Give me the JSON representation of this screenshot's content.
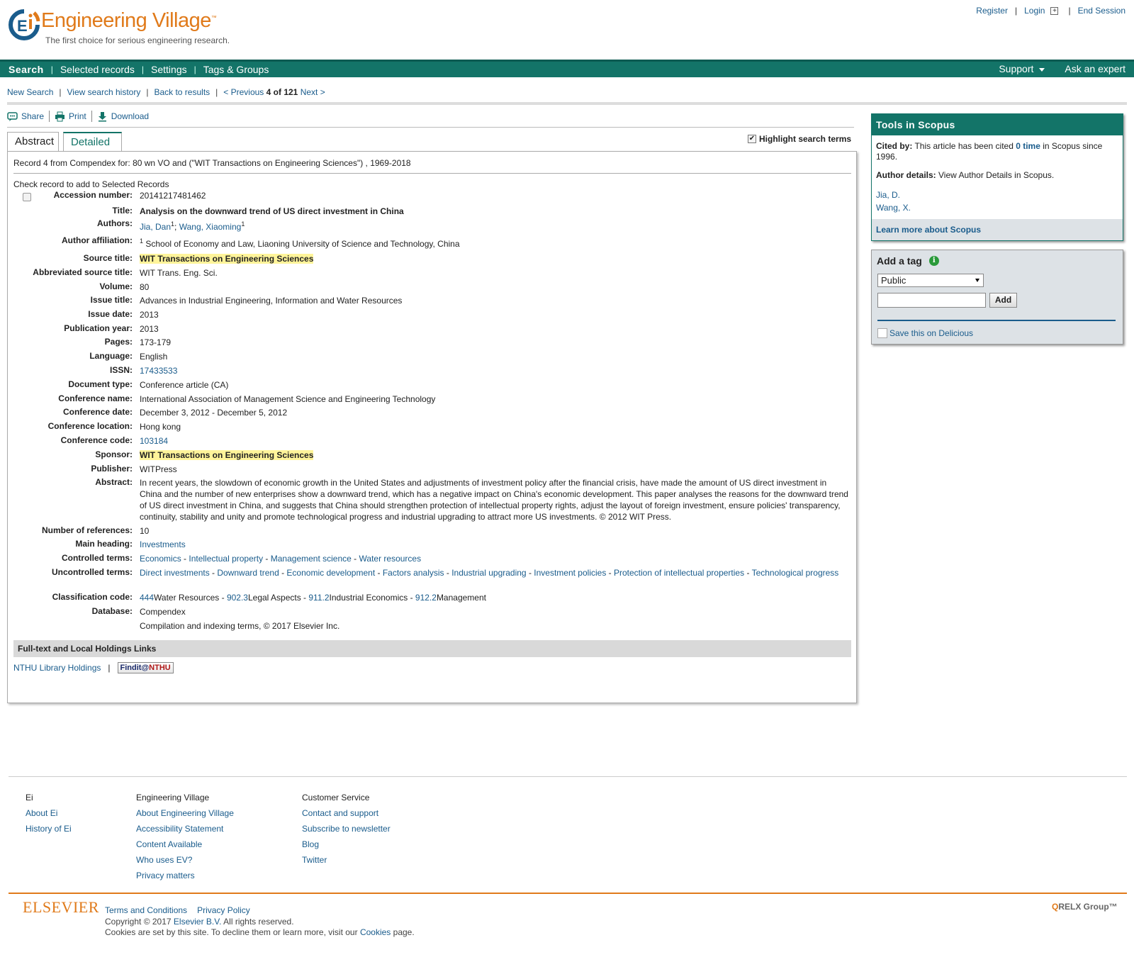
{
  "header": {
    "brand": "Engineering Village",
    "brand_tm": "™",
    "tagline": "The first choice for serious engineering research.",
    "register": "Register",
    "login": "Login",
    "end_session": "End Session"
  },
  "nav": {
    "items": [
      "Search",
      "Selected records",
      "Settings",
      "Tags & Groups"
    ],
    "support": "Support",
    "ask_expert": "Ask an expert"
  },
  "breadcrumb": {
    "new_search": "New Search",
    "history": "View search history",
    "back": "Back to results",
    "previous": "< Previous",
    "position": "4 of 121",
    "next": "Next >"
  },
  "actions": {
    "share": "Share",
    "print": "Print",
    "download": "Download"
  },
  "tabs": {
    "abstract": "Abstract",
    "detailed": "Detailed"
  },
  "highlight_label": "Highlight search terms",
  "record": {
    "heading": "Record 4 from Compendex for: 80 wn VO and (\"WIT Transactions on Engineering Sciences\") , 1969-2018",
    "check_label": "Check record to add to Selected Records",
    "accession": {
      "label": "Accession number:",
      "value": "20141217481462"
    },
    "title": {
      "label": "Title:",
      "value": "Analysis on the downward trend of US direct investment in China"
    },
    "authors": {
      "label": "Authors:",
      "a1": "Jia, Dan",
      "a2": "Wang, Xiaoming",
      "sup": "1"
    },
    "affiliation": {
      "label": "Author affiliation:",
      "sup": "1",
      "value": "School of Economy and Law, Liaoning University of Science and Technology, China"
    },
    "source_title": {
      "label": "Source title:",
      "value": "WIT Transactions on Engineering Sciences"
    },
    "abbrev": {
      "label": "Abbreviated source title:",
      "value": "WIT Trans. Eng. Sci."
    },
    "volume": {
      "label": "Volume:",
      "value": "80"
    },
    "issue_title": {
      "label": "Issue title:",
      "value": "Advances in Industrial Engineering, Information and Water Resources"
    },
    "issue_date": {
      "label": "Issue date:",
      "value": "2013"
    },
    "pub_year": {
      "label": "Publication year:",
      "value": "2013"
    },
    "pages": {
      "label": "Pages:",
      "value": "173-179"
    },
    "language": {
      "label": "Language:",
      "value": "English"
    },
    "issn": {
      "label": "ISSN:",
      "value": "17433533"
    },
    "doc_type": {
      "label": "Document type:",
      "value": "Conference article (CA)"
    },
    "conf_name": {
      "label": "Conference name:",
      "value": "International Association of Management Science and Engineering Technology"
    },
    "conf_date": {
      "label": "Conference date:",
      "value": "December 3, 2012 - December 5, 2012"
    },
    "conf_location": {
      "label": "Conference location:",
      "value": "Hong kong"
    },
    "conf_code": {
      "label": "Conference code:",
      "value": "103184"
    },
    "sponsor": {
      "label": "Sponsor:",
      "value": "WIT Transactions on Engineering Sciences"
    },
    "publisher": {
      "label": "Publisher:",
      "value": "WITPress"
    },
    "abstract": {
      "label": "Abstract:",
      "value": "In recent years, the slowdown of economic growth in the United States and adjustments of investment policy after the financial crisis, have made the amount of US direct investment in China and the number of new enterprises show a downward trend, which has a negative impact on China's economic development. This paper analyses the reasons for the downward trend of US direct investment in China, and suggests that China should strengthen protection of intellectual property rights, adjust the layout of foreign investment, ensure policies' transparency, continuity, stability and unity and promote technological progress and industrial upgrading to attract more US investments. © 2012 WIT Press."
    },
    "num_refs": {
      "label": "Number of references:",
      "value": "10"
    },
    "main_heading": {
      "label": "Main heading:",
      "value": "Investments"
    },
    "controlled": {
      "label": "Controlled terms:",
      "terms": [
        "Economics",
        "Intellectual property",
        "Management science",
        "Water resources"
      ]
    },
    "uncontrolled": {
      "label": "Uncontrolled terms:",
      "terms": [
        "Direct investments",
        "Downward trend",
        "Economic development",
        "Factors analysis",
        "Industrial upgrading",
        "Investment policies",
        "Protection of intellectual properties",
        "Technological progress"
      ]
    },
    "classification": {
      "label": "Classification code:",
      "codes": [
        {
          "code": "444",
          "name": "Water Resources"
        },
        {
          "code": "902.3",
          "name": "Legal Aspects"
        },
        {
          "code": "911.2",
          "name": "Industrial Economics"
        },
        {
          "code": "912.2",
          "name": "Management"
        }
      ]
    },
    "database": {
      "label": "Database:",
      "value": "Compendex"
    },
    "indexing": "Compilation and indexing terms, © 2017 Elsevier Inc."
  },
  "fulltext": {
    "heading": "Full-text and Local Holdings Links",
    "library": "NTHU Library Holdings",
    "findit_a": "Findit@",
    "findit_b": "NTHU"
  },
  "scopus": {
    "heading": "Tools in Scopus",
    "cited_label": "Cited by:",
    "cited_pre": "This article has been cited",
    "cited_count": "0 time",
    "cited_post": "in Scopus since 1996.",
    "author_label": "Author details:",
    "author_text": "View Author Details in Scopus.",
    "authors": [
      "Jia, D.",
      "Wang, X."
    ],
    "learn_more": "Learn more about Scopus"
  },
  "tag": {
    "title": "Add a tag",
    "visibility": "Public",
    "input_value": "",
    "add": "Add",
    "delicious": "Save this on Delicious"
  },
  "footer": {
    "ei": {
      "heading": "Ei",
      "links": [
        "About Ei",
        "History of Ei"
      ]
    },
    "ev": {
      "heading": "Engineering Village",
      "links": [
        "About Engineering Village",
        "Accessibility Statement",
        "Content Available",
        "Who uses EV?",
        "Privacy matters"
      ]
    },
    "cs": {
      "heading": "Customer Service",
      "links": [
        "Contact and support",
        "Subscribe to newsletter",
        "Blog",
        "Twitter"
      ]
    },
    "elsevier": "ELSEVIER",
    "terms": "Terms and Conditions",
    "privacy": "Privacy Policy",
    "copyright_pre": "Copyright © 2017",
    "copyright_link": "Elsevier B.V.",
    "copyright_post": "All rights reserved.",
    "cookies_pre": "Cookies are set by this site. To decline them or learn more, visit our",
    "cookies_link": "Cookies",
    "cookies_post": "page.",
    "relx": "RELX Group™"
  },
  "colors": {
    "brand_orange": "#e07a1a",
    "nav_green": "#137468",
    "link_blue": "#1a5c8c",
    "highlight": "#fff49a"
  }
}
